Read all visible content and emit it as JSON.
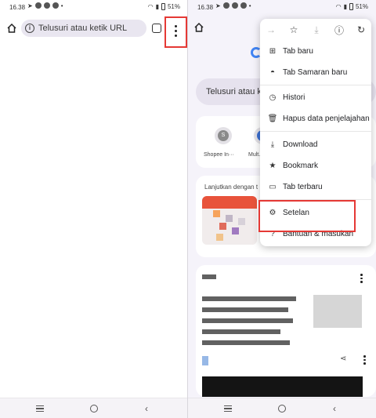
{
  "status": {
    "time": "16.38",
    "battery": "51%"
  },
  "browser": {
    "omnibox_placeholder": "Telusuri atau ketik URL"
  },
  "ntp": {
    "search_text": "Telusuri atau ke",
    "shortcuts": [
      {
        "letter": "S",
        "label": "Shopee In···"
      },
      {
        "letter": "",
        "label": "Mult.dev"
      }
    ],
    "continue_title": "Lanjutkan dengan t"
  },
  "menu": {
    "items": [
      {
        "icon": "new-tab-icon",
        "label": "Tab baru"
      },
      {
        "icon": "incognito-icon",
        "label": "Tab Samaran baru"
      },
      {
        "icon": "history-icon",
        "label": "Histori"
      },
      {
        "icon": "trash-icon",
        "label": "Hapus data penjelajahan"
      },
      {
        "icon": "download-icon",
        "label": "Download"
      },
      {
        "icon": "star-icon",
        "label": "Bookmark"
      },
      {
        "icon": "devices-icon",
        "label": "Tab terbaru"
      },
      {
        "icon": "gear-icon",
        "label": "Setelan"
      },
      {
        "icon": "help-icon",
        "label": "Bantuan & masukan"
      }
    ]
  },
  "colors": {
    "highlight": "#e53935",
    "accent": "#4285f4"
  }
}
